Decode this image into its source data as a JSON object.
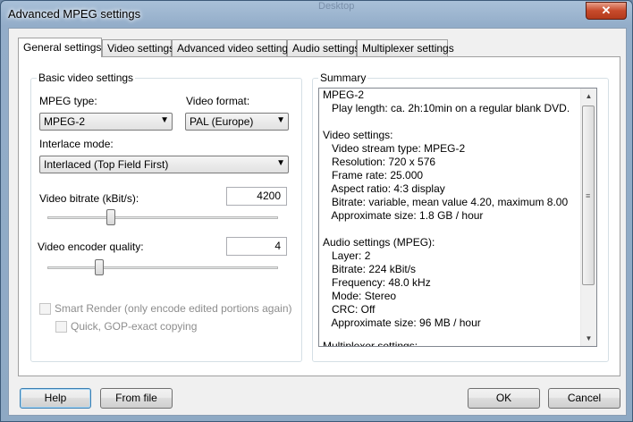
{
  "window": {
    "title": "Advanced MPEG settings",
    "ghost_text": "Desktop",
    "close_glyph": "✕"
  },
  "tabs": [
    {
      "label": "General settings",
      "active": true
    },
    {
      "label": "Video settings"
    },
    {
      "label": "Advanced video settings"
    },
    {
      "label": "Audio settings"
    },
    {
      "label": "Multiplexer settings"
    }
  ],
  "basic": {
    "group_label": "Basic video settings",
    "mpeg_type_label": "MPEG type:",
    "mpeg_type_value": "MPEG-2",
    "video_format_label": "Video format:",
    "video_format_value": "PAL (Europe)",
    "interlace_label": "Interlace mode:",
    "interlace_value": "Interlaced (Top Field First)",
    "bitrate_label": "Video bitrate (kBit/s):",
    "bitrate_value": "4200",
    "quality_label": "Video encoder quality:",
    "quality_value": "4",
    "smart_render_label": "Smart Render (only encode edited portions again)",
    "quick_gop_label": "Quick, GOP-exact copying"
  },
  "summary": {
    "group_label": "Summary",
    "lines": [
      "MPEG-2",
      "   Play length: ca. 2h:10min on a regular blank DVD.",
      "",
      "Video settings:",
      "   Video stream type: MPEG-2",
      "   Resolution: 720 x 576",
      "   Frame rate: 25.000",
      "   Aspect ratio: 4:3 display",
      "   Bitrate: variable, mean value 4.20, maximum 8.00",
      "   Approximate size: 1.8 GB / hour",
      "",
      "Audio settings (MPEG):",
      "   Layer: 2",
      "   Bitrate: 224 kBit/s",
      "   Frequency: 48.0 kHz",
      "   Mode: Stereo",
      "   CRC: Off",
      "   Approximate size: 96 MB / hour",
      "",
      "Multiplexer settings:"
    ]
  },
  "buttons": {
    "help": "Help",
    "from_file": "From file",
    "ok": "OK",
    "cancel": "Cancel"
  },
  "icons": {
    "combo_arrow": "▼",
    "scroll_up": "▲",
    "scroll_down": "▼",
    "grip": "≡"
  }
}
